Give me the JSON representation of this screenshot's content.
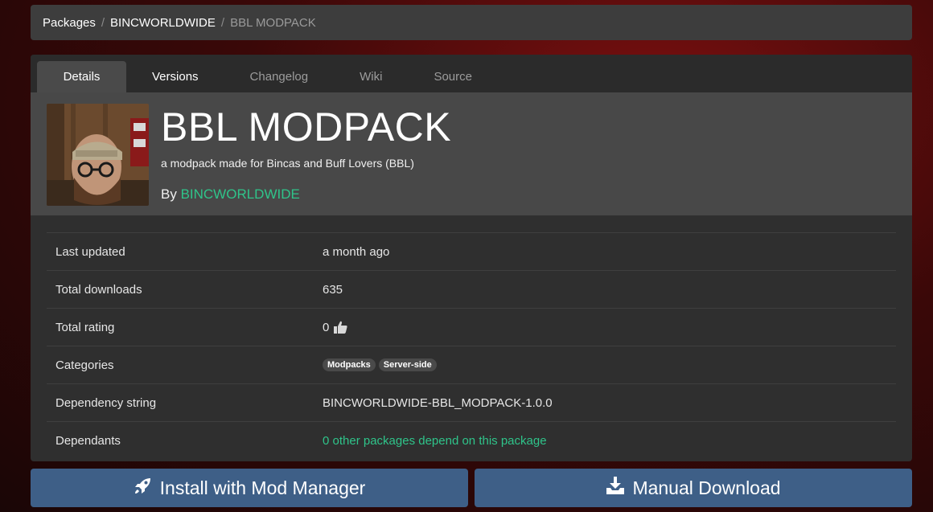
{
  "breadcrumb": {
    "packages": "Packages",
    "sep": "/",
    "owner": "BINCWORLDWIDE",
    "current": "BBL MODPACK"
  },
  "tabs": [
    {
      "label": "Details"
    },
    {
      "label": "Versions"
    },
    {
      "label": "Changelog"
    },
    {
      "label": "Wiki"
    },
    {
      "label": "Source"
    }
  ],
  "package": {
    "title": "BBL MODPACK",
    "description": "a modpack made for Bincas and Buff Lovers (BBL)",
    "by_prefix": "By ",
    "author": "BINCWORLDWIDE"
  },
  "info": {
    "last_updated_label": "Last updated",
    "last_updated_value": "a month ago",
    "total_downloads_label": "Total downloads",
    "total_downloads_value": "635",
    "total_rating_label": "Total rating",
    "total_rating_value": "0",
    "categories_label": "Categories",
    "categories": [
      "Modpacks",
      "Server-side"
    ],
    "dependency_string_label": "Dependency string",
    "dependency_string_value": "BINCWORLDWIDE-BBL_MODPACK-1.0.0",
    "dependants_label": "Dependants",
    "dependants_value": "0 other packages depend on this package"
  },
  "actions": {
    "install_label": "Install with Mod Manager",
    "manual_label": "Manual Download"
  },
  "icons": {
    "rating": "thumbs-up-icon",
    "install": "rocket-icon",
    "manual": "download-icon"
  },
  "colors": {
    "accent_link": "#2fc48a",
    "button": "#3e5f87"
  }
}
